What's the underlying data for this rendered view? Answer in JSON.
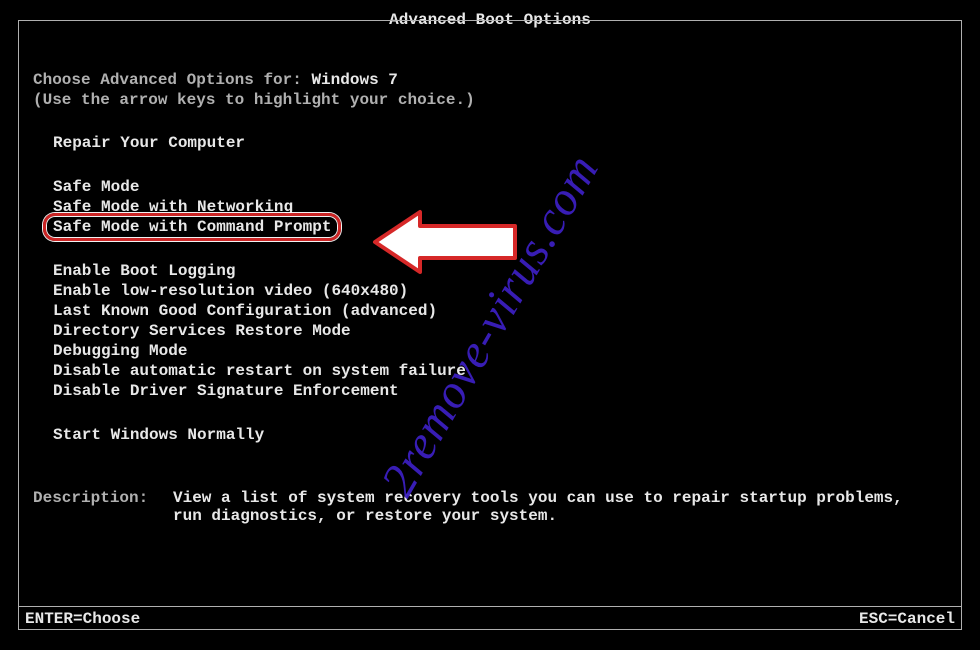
{
  "title": "Advanced Boot Options",
  "choose_prefix": "Choose Advanced Options for: ",
  "os": "Windows 7",
  "hint": "(Use the arrow keys to highlight your choice.)",
  "groups": {
    "repair": "Repair Your Computer",
    "safe1": "Safe Mode",
    "safe2": "Safe Mode with Networking",
    "safe3_highlighted": "Safe Mode with Command Prompt",
    "g3_1": "Enable Boot Logging",
    "g3_2": "Enable low-resolution video (640x480)",
    "g3_3": "Last Known Good Configuration (advanced)",
    "g3_4": "Directory Services Restore Mode",
    "g3_5": "Debugging Mode",
    "g3_6": "Disable automatic restart on system failure",
    "g3_7": "Disable Driver Signature Enforcement",
    "normal": "Start Windows Normally"
  },
  "description_label": "Description:",
  "description_text": "View a list of system recovery tools you can use to repair startup problems, run diagnostics, or restore your system.",
  "footer_left": "ENTER=Choose",
  "footer_right": "ESC=Cancel",
  "watermark": "2remove-virus.com"
}
